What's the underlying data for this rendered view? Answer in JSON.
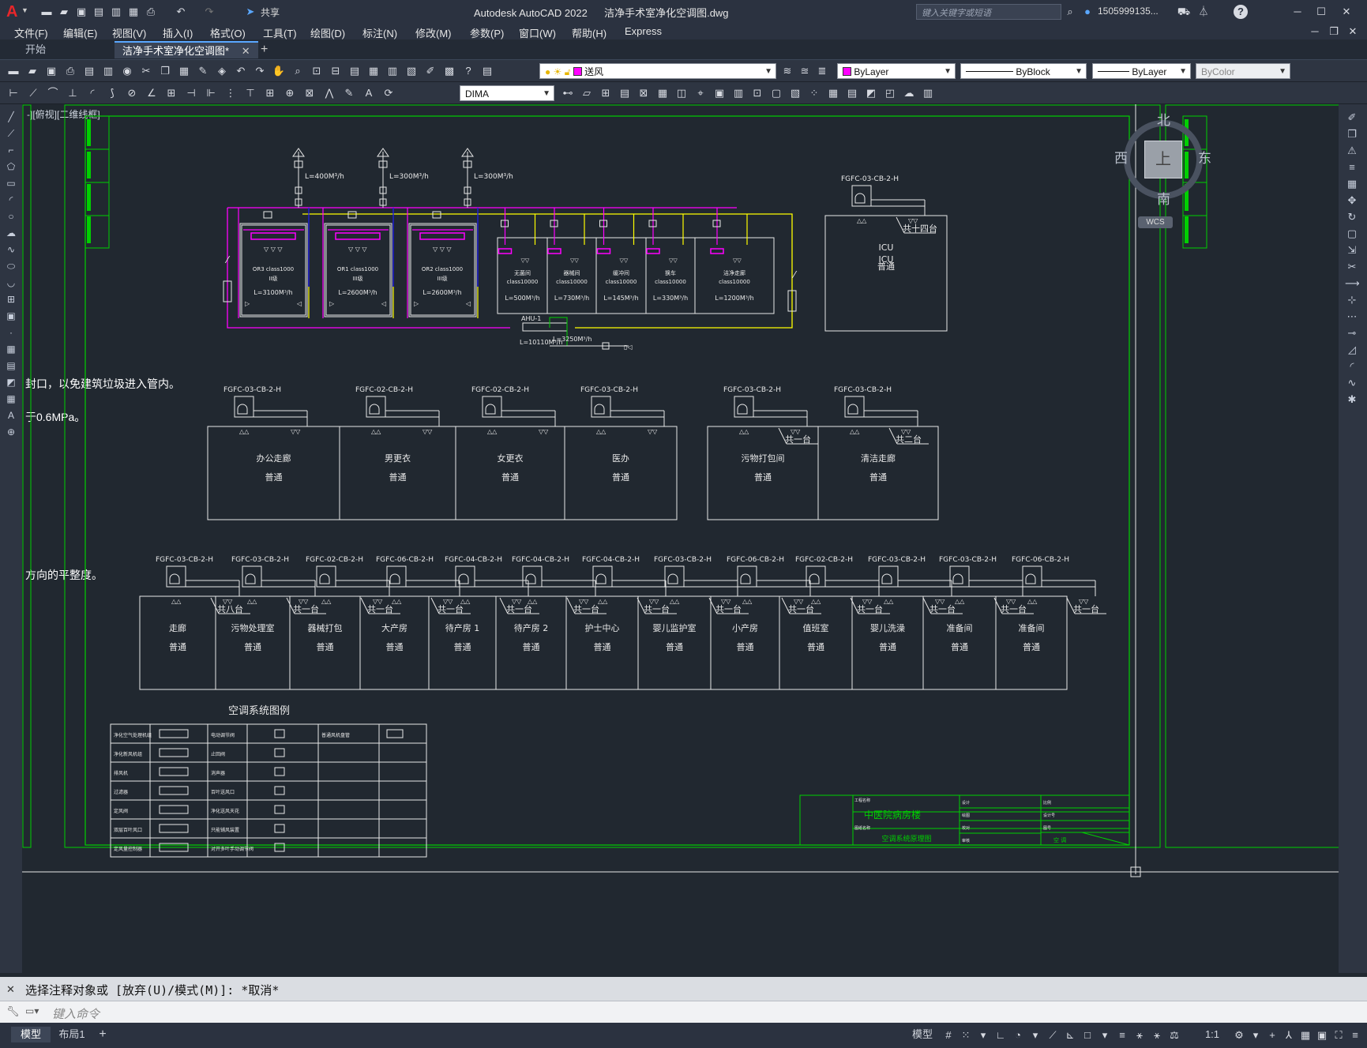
{
  "title_bar": {
    "app_title": "Autodesk AutoCAD 2022",
    "file_name": "洁净手术室净化空调图.dwg",
    "share_label": "共享",
    "search_placeholder": "键入关键字或短语",
    "user": "1505999135...",
    "help": "?"
  },
  "menu": [
    "文件(F)",
    "编辑(E)",
    "视图(V)",
    "插入(I)",
    "格式(O)",
    "工具(T)",
    "绘图(D)",
    "标注(N)",
    "修改(M)",
    "参数(P)",
    "窗口(W)",
    "帮助(H)",
    "Express"
  ],
  "tabs": [
    {
      "label": "开始",
      "active": false
    },
    {
      "label": "洁净手术室净化空调图*",
      "active": true
    }
  ],
  "ribbon": {
    "layer_value": "送风",
    "color_value": "ByLayer",
    "linetype_value": "ByBlock",
    "lineweight_value": "ByLayer",
    "plotstyle_value": "ByColor",
    "dimstyle_value": "DIMA"
  },
  "viewcube": {
    "north": "北",
    "south": "南",
    "west": "西",
    "east": "东",
    "face": "上",
    "wcs": "WCS"
  },
  "viewport_label": "-][俯视][二维线框]",
  "side_notes": [
    "封口，以免建筑垃圾进入管内。",
    "于0.6MPa。",
    "方向的平整度。"
  ],
  "drawing": {
    "colors": {
      "frame": "#00d000",
      "magenta": "#ff00ff",
      "yellow": "#ffff00",
      "blue": "#0000ff",
      "white": "#e8e8e8"
    },
    "risers": [
      {
        "label": "L=400M³/h"
      },
      {
        "label": "L=300M³/h"
      },
      {
        "label": "L=300M³/h"
      }
    ],
    "or_rooms": [
      {
        "name": "OR3 class1000",
        "grade": "II级",
        "flow": "L=3100M³/h"
      },
      {
        "name": "OR1 class1000",
        "grade": "III级",
        "flow": "L=2600M³/h"
      },
      {
        "name": "OR2 class1000",
        "grade": "III级",
        "flow": "L=2600M³/h"
      }
    ],
    "aux_rooms": [
      {
        "name": "无菌间",
        "cls": "class10000",
        "flow": "L=500M³/h"
      },
      {
        "name": "器械间",
        "cls": "class10000",
        "flow": "L=730M³/h"
      },
      {
        "name": "缓冲间",
        "cls": "class10000",
        "flow": "L=145M³/h"
      },
      {
        "name": "换车",
        "cls": "class10000",
        "flow": "L=330M³/h"
      },
      {
        "name": "洁净走廊",
        "cls": "class10000",
        "flow": "L=1200M³/h"
      }
    ],
    "ahu": {
      "label": "AHU-1",
      "flow1": "L=10110M³/h",
      "flow2": "L=3250M³/h"
    },
    "icu": {
      "model": "FGFC-03-CB-2-H",
      "count": "共十四台",
      "name": "ICU",
      "grade": "普通"
    },
    "row1": [
      {
        "model": "FGFC-03-CB-2-H",
        "name": "办公走廊",
        "grade": "普通",
        "count": ""
      },
      {
        "model": "FGFC-02-CB-2-H",
        "name": "男更衣",
        "grade": "普通",
        "count": ""
      },
      {
        "model": "FGFC-02-CB-2-H",
        "name": "女更衣",
        "grade": "普通",
        "count": ""
      },
      {
        "model": "FGFC-03-CB-2-H",
        "name": "医办",
        "grade": "普通",
        "count": ""
      },
      {
        "model": "FGFC-03-CB-2-H",
        "name": "污物打包间",
        "grade": "普通",
        "count": "共一台"
      },
      {
        "model": "FGFC-03-CB-2-H",
        "name": "清洁走廊",
        "grade": "普通",
        "count": "共二台"
      }
    ],
    "row2": [
      {
        "model": "FGFC-03-CB-2-H",
        "name": "走廊",
        "grade": "普通",
        "count": "共八台"
      },
      {
        "model": "FGFC-03-CB-2-H",
        "name": "污物处理室",
        "grade": "普通",
        "count": "共一台"
      },
      {
        "model": "FGFC-02-CB-2-H",
        "name": "器械打包",
        "grade": "普通",
        "count": "共一台"
      },
      {
        "model": "FGFC-06-CB-2-H",
        "name": "大产房",
        "grade": "普通",
        "count": "共一台"
      },
      {
        "model": "FGFC-04-CB-2-H",
        "name": "待产房 1",
        "grade": "普通",
        "count": "共一台"
      },
      {
        "model": "FGFC-04-CB-2-H",
        "name": "待产房 2",
        "grade": "普通",
        "count": "共一台"
      },
      {
        "model": "FGFC-04-CB-2-H",
        "name": "护士中心",
        "grade": "普通",
        "count": "共一台"
      },
      {
        "model": "FGFC-03-CB-2-H",
        "name": "婴儿监护室",
        "grade": "普通",
        "count": "共一台"
      },
      {
        "model": "FGFC-06-CB-2-H",
        "name": "小产房",
        "grade": "普通",
        "count": "共一台"
      },
      {
        "model": "FGFC-02-CB-2-H",
        "name": "值班室",
        "grade": "普通",
        "count": "共一台"
      },
      {
        "model": "FGFC-03-CB-2-H",
        "name": "婴儿洗澡",
        "grade": "普通",
        "count": "共一台"
      },
      {
        "model": "FGFC-03-CB-2-H",
        "name": "准备间",
        "grade": "普通",
        "count": "共一台"
      },
      {
        "model": "FGFC-06-CB-2-H",
        "name": "准备间",
        "grade": "普通",
        "count": "共一台"
      }
    ],
    "legend_title": "空调系统图例",
    "legend_rows": [
      {
        "a": "净化空气处理机组",
        "b": "电动调节阀",
        "c": "普通风机盘管"
      },
      {
        "a": "净化新风机组",
        "b": "止回阀",
        "c": ""
      },
      {
        "a": "排风机",
        "b": "消声器",
        "c": ""
      },
      {
        "a": "过滤器",
        "b": "百叶送风口",
        "c": ""
      },
      {
        "a": "定风阀",
        "b": "净化送风天花",
        "c": ""
      },
      {
        "a": "双层百叶风口",
        "b": "只能铺风装置",
        "c": ""
      },
      {
        "a": "定风量控制器",
        "b": "对开多叶手动调节阀",
        "c": ""
      }
    ],
    "title_block": {
      "project_label": "工程名称",
      "project": "中医院病房楼",
      "drawing_label": "图纸名称",
      "drawing": "空调系统原理图",
      "design": "设计",
      "draw": "绘图",
      "check": "校对",
      "review": "审核",
      "scale": "比例",
      "sheet_no": "图号",
      "project_no": "设计号",
      "discipline": "空 调"
    }
  },
  "command": {
    "history": "选择注释对象或 [放弃(U)/模式(M)]: *取消*",
    "placeholder": "键入命令"
  },
  "status": {
    "model_tab": "模型",
    "layout_tab": "布局1",
    "add_tab": "+",
    "mode": "模型",
    "scale": "1:1"
  }
}
